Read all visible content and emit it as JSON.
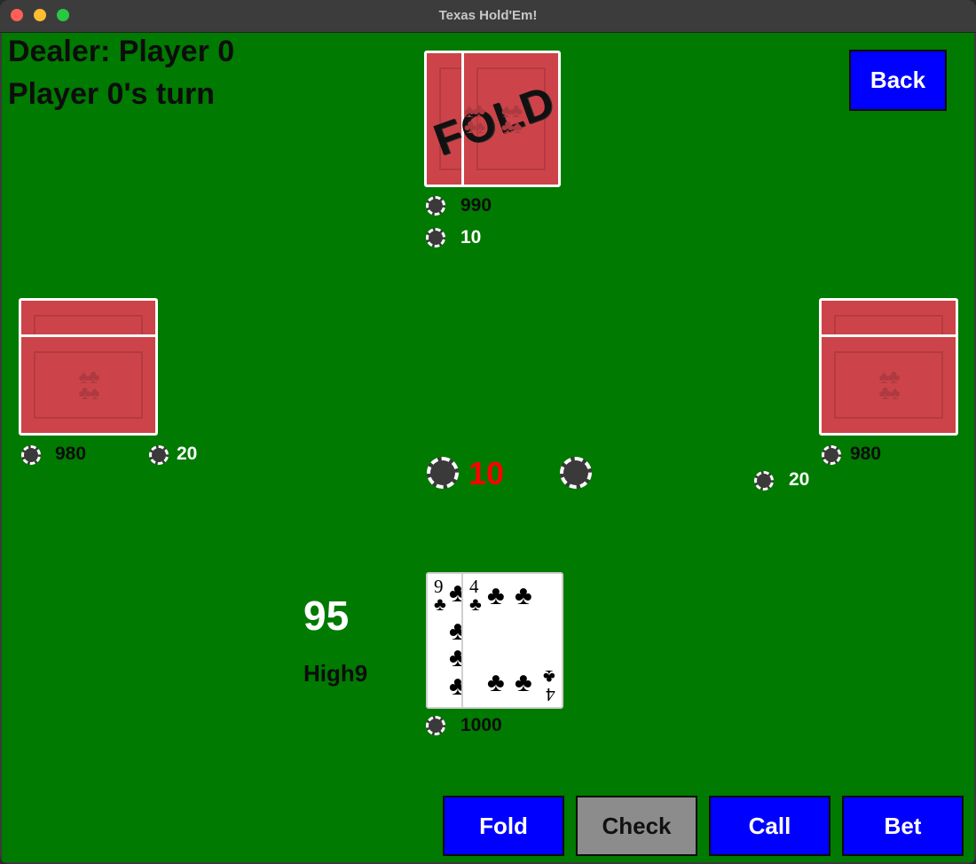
{
  "window": {
    "title": "Texas Hold'Em!"
  },
  "status": {
    "dealer": "Dealer: Player 0",
    "turn": "Player 0's turn"
  },
  "buttons": {
    "back": "Back",
    "fold": "Fold",
    "check": "Check",
    "call": "Call",
    "bet": "Bet"
  },
  "players": {
    "top": {
      "chips": "990",
      "bet": "10",
      "folded_label": "FOLD"
    },
    "left": {
      "chips": "980",
      "bet": "20"
    },
    "right": {
      "chips": "980",
      "bet": "20"
    },
    "bottom": {
      "chips": "1000",
      "score": "95",
      "hand_name": "High9",
      "cards": [
        {
          "rank": "9",
          "suit": "♣"
        },
        {
          "rank": "4",
          "suit": "♣"
        }
      ]
    }
  },
  "pot": {
    "amount": "10"
  },
  "icons": {
    "chip": "poker-chip-icon",
    "card_back": "card-back-icon",
    "suit": "club-icon"
  },
  "colors": {
    "table": "#007a00",
    "button": "#0000ff",
    "button_disabled": "#8c8c8c",
    "card_back": "#cc4449",
    "pot_text": "#ff0000"
  }
}
